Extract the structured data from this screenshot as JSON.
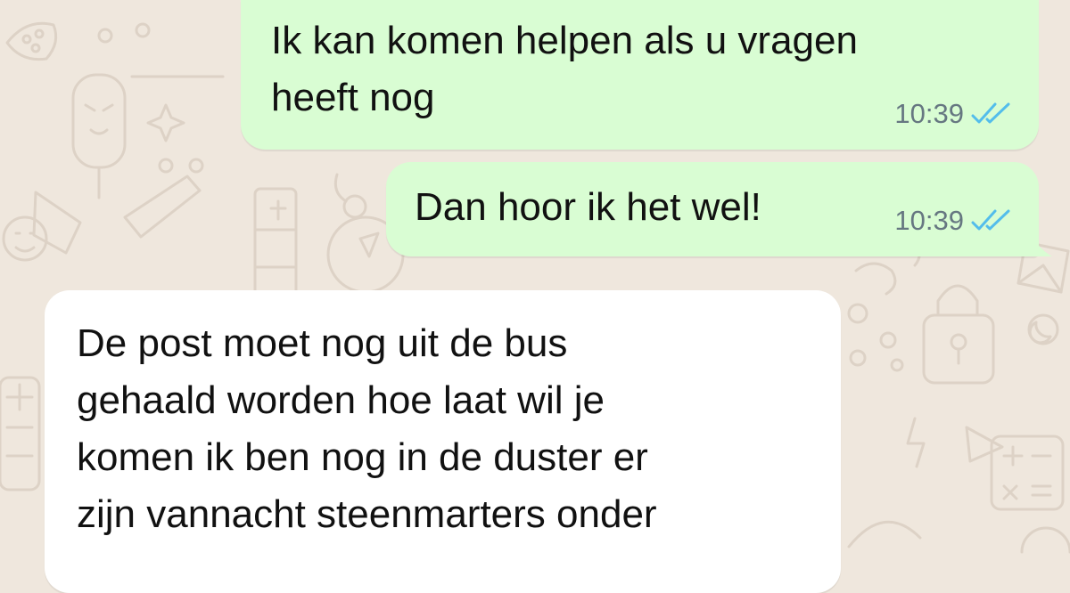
{
  "colors": {
    "background": "#efe7dd",
    "doodle": "#ddd2c6",
    "outgoing_bubble": "#d9fdd3",
    "incoming_bubble": "#ffffff",
    "timestamp": "#667781",
    "read_ticks": "#53bdeb"
  },
  "wallpaper": {
    "icons": [
      "cake-doodle-icon",
      "popsicle-doodle-icon",
      "sparkle-doodle-icon",
      "pen-doodle-icon",
      "calendar-doodle-icon",
      "compass-doodle-icon",
      "lock-doodle-icon",
      "moon-doodle-icon",
      "mail-doodle-icon",
      "calculator-doodle-icon"
    ]
  },
  "messages": [
    {
      "direction": "outgoing",
      "lines": [
        "Ik kan komen helpen als u vragen",
        "heeft nog"
      ],
      "time": "10:39",
      "status": "read",
      "status_icon": "double-check-icon"
    },
    {
      "direction": "outgoing",
      "lines": [
        "Dan hoor ik het wel!"
      ],
      "time": "10:39",
      "status": "read",
      "status_icon": "double-check-icon"
    },
    {
      "direction": "incoming",
      "lines": [
        "De post moet nog uit de bus",
        "gehaald worden hoe laat wil je",
        "komen ik ben nog in de duster er",
        "zijn vannacht steenmarters onder"
      ]
    }
  ]
}
